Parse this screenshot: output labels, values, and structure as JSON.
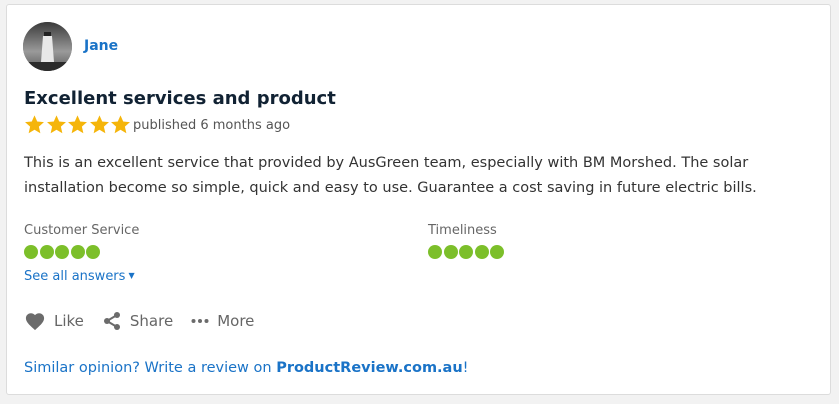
{
  "review": {
    "reviewer_name": "Jane",
    "title": "Excellent services and product",
    "rating_stars": 5,
    "published": "published 6 months ago",
    "body": "This is an excellent service that provided by AusGreen team, especially with BM Morshed. The solar installation become so simple, quick and easy to use. Guarantee a cost saving in future electric bills."
  },
  "ratings": [
    {
      "label": "Customer Service",
      "score": 5
    },
    {
      "label": "Timeliness",
      "score": 5
    }
  ],
  "see_all": "See all answers",
  "actions": {
    "like": "Like",
    "share": "Share",
    "more": "More"
  },
  "footer": {
    "prefix": "Similar opinion? Write a review on ",
    "brand": "ProductReview.com.au",
    "suffix": "!"
  },
  "colors": {
    "link": "#1a73c7",
    "star": "#f5b50a",
    "dot": "#7cbf2a"
  }
}
